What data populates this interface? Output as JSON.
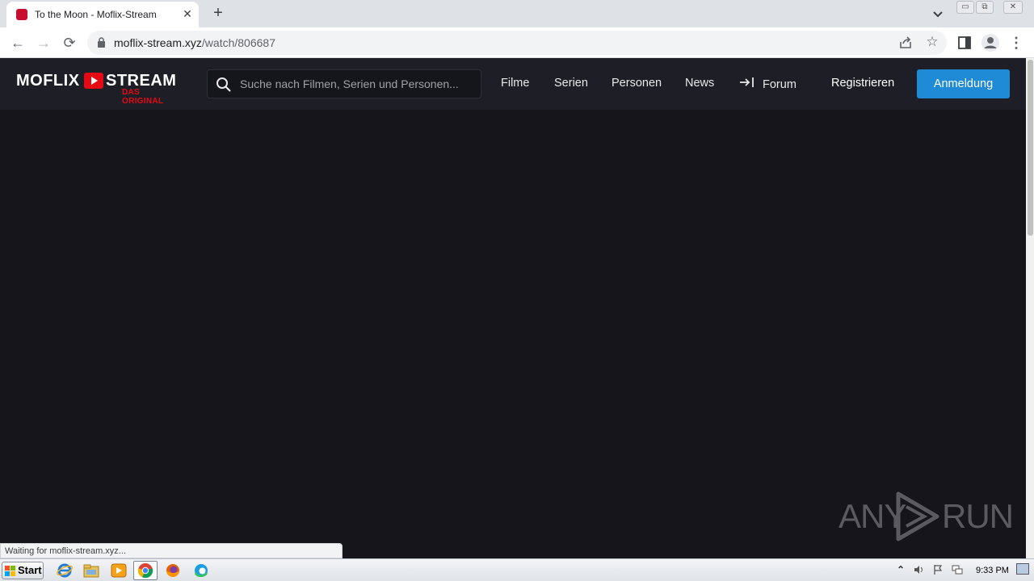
{
  "browser": {
    "tab": {
      "title": "To the Moon - Moflix-Stream",
      "close_glyph": "✕",
      "favicon": "moflix-favicon"
    },
    "new_tab_glyph": "+",
    "window_controls": {
      "minimize": "▭",
      "maximize": "⧉",
      "close": "✕"
    },
    "nav": {
      "back_glyph": "←",
      "forward_glyph": "→",
      "reload_glyph": "⟳"
    },
    "address": {
      "host": "moflix-stream.xyz",
      "path": "/watch/806687"
    },
    "star_glyph": "☆",
    "menu_glyph": "⋮",
    "status_text": "Waiting for moflix-stream.xyz..."
  },
  "site": {
    "logo": {
      "word1": "MOFLIX",
      "word2": "STREAM",
      "tagline": "DAS ORIGINAL"
    },
    "search": {
      "placeholder": "Suche nach Filmen, Serien und Personen..."
    },
    "nav": [
      {
        "label": "Filme"
      },
      {
        "label": "Serien"
      },
      {
        "label": "Personen"
      },
      {
        "label": "News"
      },
      {
        "label": "Forum",
        "icon": "sign-in-icon"
      }
    ],
    "register_label": "Registrieren",
    "login_label": "Anmeldung",
    "colors": {
      "header_bg": "#1e1f26",
      "page_bg": "#15151b",
      "brand_red": "#e50914",
      "login_blue": "#1f8ad5"
    }
  },
  "watermark": {
    "left": "ANY",
    "right": "RUN"
  },
  "taskbar": {
    "start_label": "Start",
    "apps": [
      "ie-icon",
      "explorer-icon",
      "media-player-icon",
      "chrome-icon",
      "firefox-icon",
      "edge-icon"
    ],
    "clock": "9:33 PM",
    "tray_up_glyph": "⌃"
  }
}
